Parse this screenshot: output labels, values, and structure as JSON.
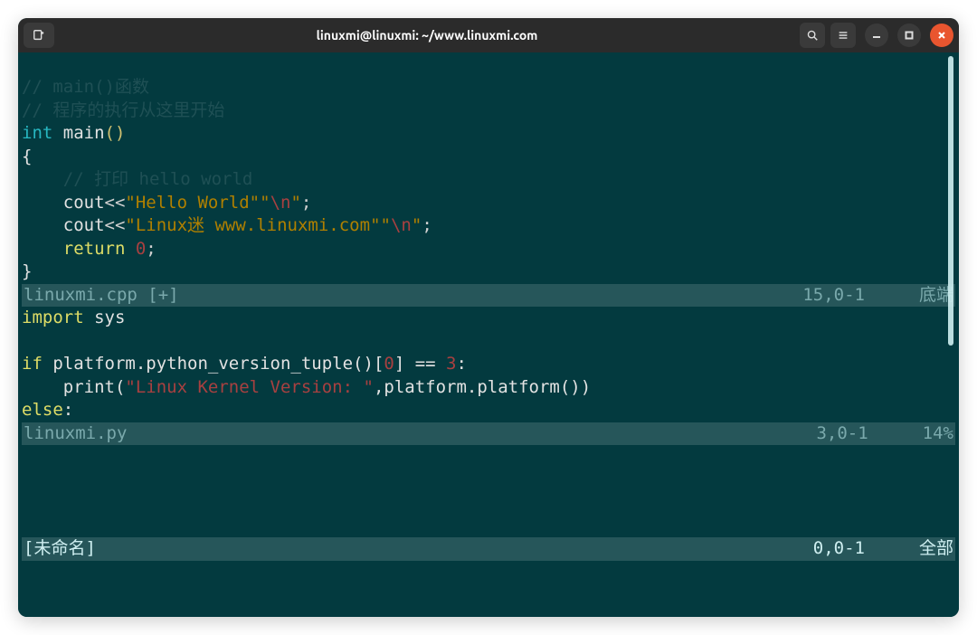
{
  "titlebar": {
    "title": "linuxmi@linuxmi: ~/www.linuxmi.com"
  },
  "pane_cpp": {
    "filename": "linuxmi.cpp",
    "modified_flag": "[+]",
    "position": "15,0-1",
    "percent": "底端",
    "lines": {
      "c1": "// main()函数",
      "c2": "// 程序的执行从这里开始",
      "type_int": "int",
      "main": " main",
      "lparen": "(",
      "rparen": ")",
      "lbrace": "{",
      "c3": "    // 打印 hello world",
      "cout1": "    cout",
      "dless1": "<<",
      "s1a": "\"Hello World\"",
      "s1b": "\"",
      "esc1": "\\n",
      "s1c": "\"",
      "semi": ";",
      "cout2": "    cout",
      "dless2": "<<",
      "s2a": "\"Linux迷 www.linuxmi.com\"",
      "s2b": "\"",
      "esc2": "\\n",
      "s2c": "\"",
      "semi2": ";",
      "ret": "    return",
      "zero": " 0",
      "semi3": ";",
      "rbrace": "}"
    }
  },
  "pane_py": {
    "filename": "linuxmi.py",
    "position": "3,0-1",
    "percent": "14%",
    "lines": {
      "import": "import",
      "sys": " sys",
      "if": "if",
      "cond1": " platform.python_version_tuple()[",
      "idx0": "0",
      "cond2": "] == ",
      "three": "3",
      "colon1": ":",
      "print": "    print",
      "pl": "(",
      "pstr": "\"Linux Kernel Version: \"",
      "comma": ",platform.platform())",
      "else": "else",
      "colon2": ":"
    }
  },
  "pane_empty": {
    "filename": "[未命名]",
    "position": "0,0-1",
    "percent": "全部"
  }
}
